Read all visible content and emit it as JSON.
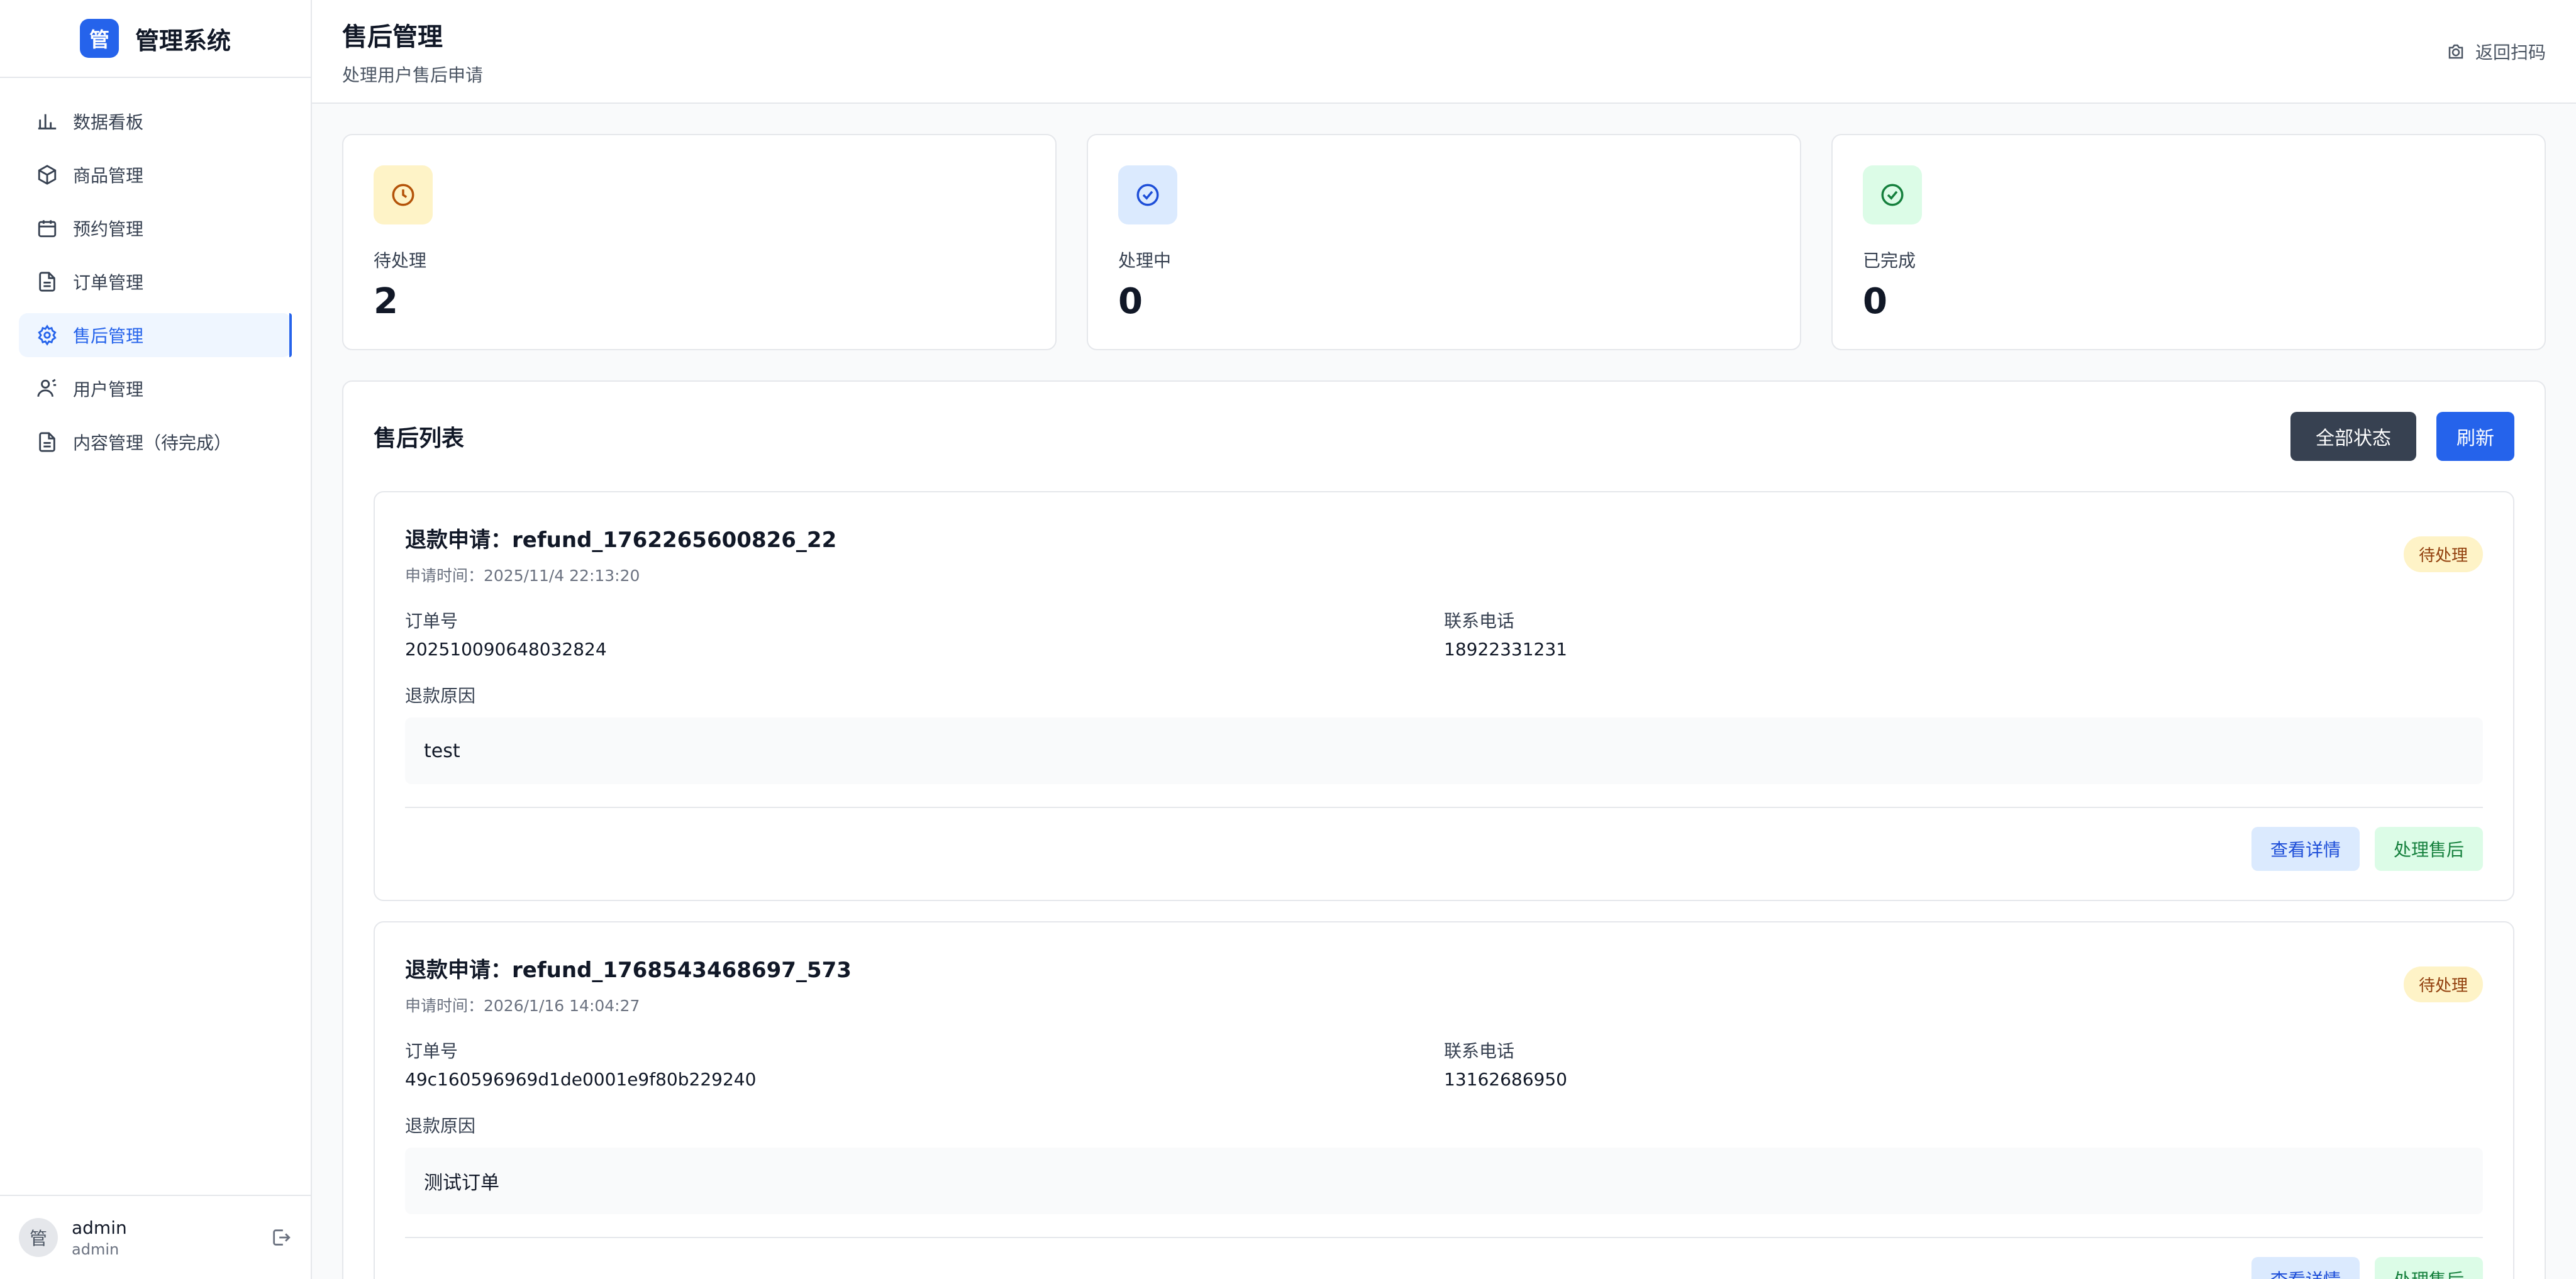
{
  "brand": {
    "logo_text": "管",
    "name": "管理系统"
  },
  "sidebar": {
    "items": [
      {
        "label": "数据看板",
        "icon": "bar-chart-icon",
        "active": false
      },
      {
        "label": "商品管理",
        "icon": "box-icon",
        "active": false
      },
      {
        "label": "预约管理",
        "icon": "calendar-icon",
        "active": false
      },
      {
        "label": "订单管理",
        "icon": "file-icon",
        "active": false
      },
      {
        "label": "售后管理",
        "icon": "gear-icon",
        "active": true
      },
      {
        "label": "用户管理",
        "icon": "user-icon",
        "active": false
      },
      {
        "label": "内容管理（待完成）",
        "icon": "file-icon",
        "active": false
      }
    ]
  },
  "user": {
    "avatar_text": "管",
    "name": "admin",
    "role": "admin"
  },
  "header": {
    "title": "售后管理",
    "subtitle": "处理用户售后申请",
    "back_label": "返回扫码"
  },
  "stats": [
    {
      "label": "待处理",
      "value": "2",
      "icon": "clock-icon",
      "color": "#b45309"
    },
    {
      "label": "处理中",
      "value": "0",
      "icon": "check-circle-icon",
      "color": "#1d4ed8"
    },
    {
      "label": "已完成",
      "value": "0",
      "icon": "check-circle-icon",
      "color": "#15803d"
    }
  ],
  "list": {
    "title": "售后列表",
    "filter_label": "全部状态",
    "refresh_label": "刷新",
    "order_no_label": "订单号",
    "phone_label": "联系电话",
    "reason_label": "退款原因",
    "detail_label": "查看详情",
    "process_label": "处理售后",
    "items": [
      {
        "title": "退款申请：refund_1762265600826_22",
        "time": "申请时间：2025/11/4 22:13:20",
        "status": "待处理",
        "order_no": "202510090648032824",
        "phone": "18922331231",
        "reason": "test"
      },
      {
        "title": "退款申请：refund_1768543468697_573",
        "time": "申请时间：2026/1/16 14:04:27",
        "status": "待处理",
        "order_no": "49c160596969d1de0001e9f80b229240",
        "phone": "13162686950",
        "reason": "测试订单"
      }
    ]
  },
  "colors": {
    "accent": "#2563eb",
    "pending_bg": "#fef3c7",
    "pending_text": "#92400e",
    "filter_bg": "#374151"
  }
}
